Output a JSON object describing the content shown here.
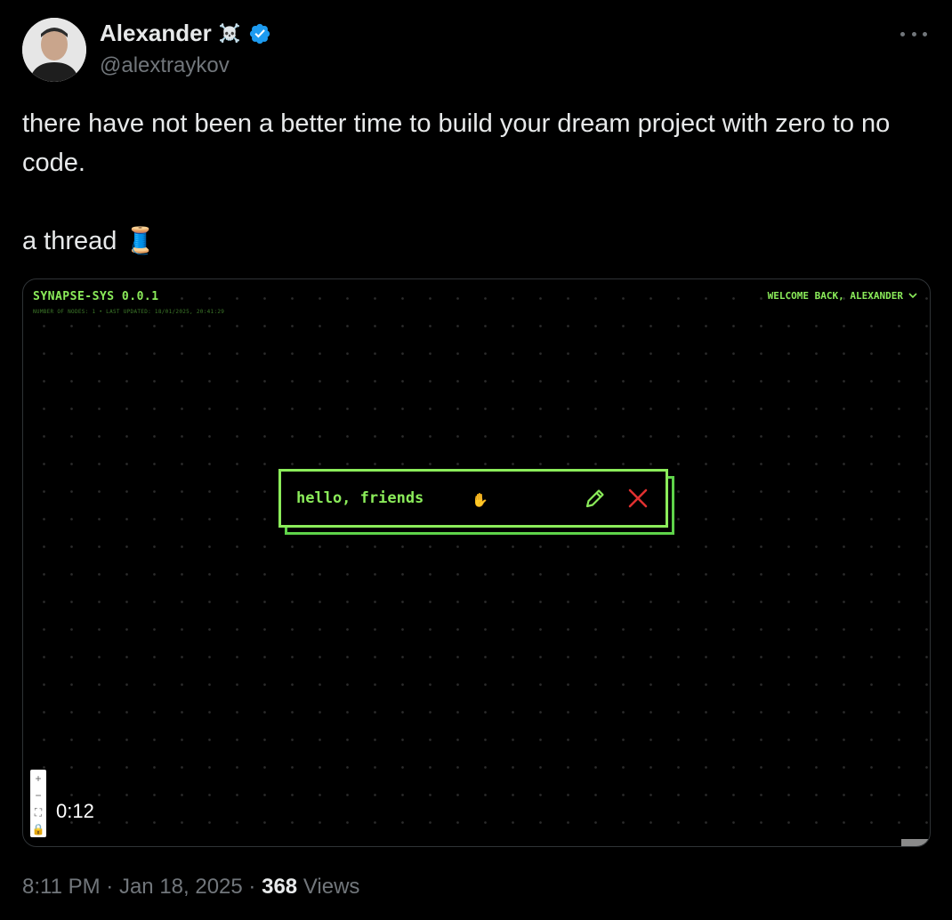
{
  "author": {
    "name": "Alexander",
    "badge_emoji": "☠️",
    "handle": "@alextraykov",
    "verified": true,
    "verified_color": "#1d9bf0"
  },
  "tweet": {
    "line1": "there have not been a better time to build your dream project with zero to no code.",
    "line2": "a thread 🧵"
  },
  "media": {
    "app_title": "SYNAPSE-SYS 0.0.1",
    "app_subtitle": "NUMBER OF NODES: 1 • LAST UPDATED: 18/01/2025, 20:41:29",
    "welcome": "WELCOME BACK, ALEXANDER",
    "node_text": "hello, friends",
    "zoom_in": "+",
    "zoom_out": "−",
    "fit": "⛶",
    "lock": "🔒",
    "video_time": "0:12",
    "accent_color": "#8bec5a",
    "close_color": "#e03030"
  },
  "meta": {
    "time": "8:11 PM",
    "date": "Jan 18, 2025",
    "views_count": "368",
    "views_label": "Views"
  }
}
